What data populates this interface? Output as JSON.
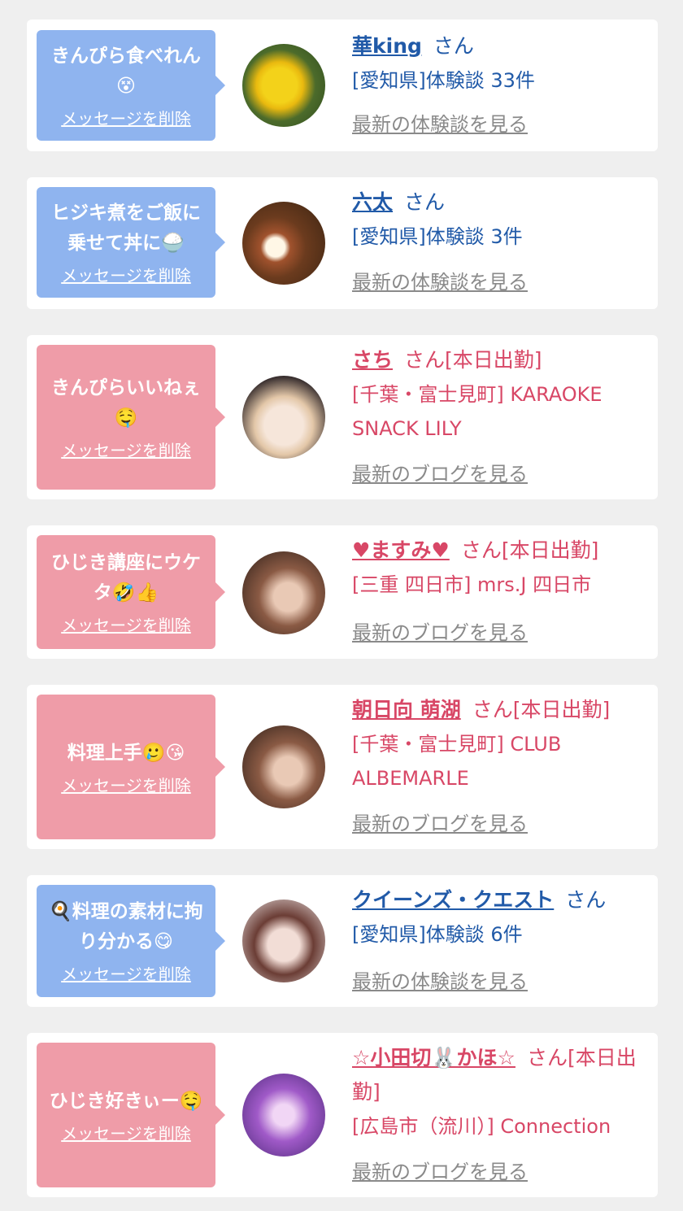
{
  "delete_label": "メッセージを削除",
  "colors": {
    "background": "#efefef",
    "male_bubble": "#8fb4ef",
    "female_bubble": "#ef9ca8",
    "male_text": "#215aa8",
    "female_text": "#d84766",
    "link_gray": "#8a8a8a"
  },
  "cards": [
    {
      "type": "male",
      "message": "きんぴら食べれん\n😵",
      "delete": "メッセージを削除",
      "name": "華king",
      "suffix": "さん",
      "detail": "[愛知県]体験談 33件",
      "latest": "最新の体験談を見る",
      "avatar": "yellow-hibiscus-photo"
    },
    {
      "type": "male",
      "message": "ヒジキ煮をご飯に\n乗せて丼に🍚",
      "delete": "メッセージを削除",
      "name": "六太",
      "suffix": "さん",
      "detail": "[愛知県]体験談 3件",
      "latest": "最新の体験談を見る",
      "avatar": "restaurant-dish-photo"
    },
    {
      "type": "female",
      "message": "きんぴらいいねぇ\n🤤",
      "delete": "メッセージを削除",
      "name": "さち",
      "suffix": "さん[本日出勤]",
      "detail": "[千葉・富士見町] KARAOKE SNACK LILY",
      "latest": "最新のブログを見る",
      "avatar": "blonde-woman-photo"
    },
    {
      "type": "female",
      "message": "ひじき講座にウケ\nタ🤣👍",
      "delete": "メッセージを削除",
      "name": "♥ますみ♥",
      "suffix": "さん[本日出勤]",
      "detail": "[三重 四日市] mrs.J 四日市",
      "latest": "最新のブログを見る",
      "avatar": "woman-portrait-photo"
    },
    {
      "type": "female",
      "message": "料理上手🥲😘",
      "delete": "メッセージを削除",
      "name": "朝日向 萌湖",
      "suffix": "さん[本日出勤]",
      "detail": "[千葉・富士見町] CLUB ALBEMARLE",
      "latest": "最新のブログを見る",
      "avatar": "woman-portrait-photo"
    },
    {
      "type": "male",
      "message": "🍳料理の素材に拘\nり分かる😋",
      "delete": "メッセージを削除",
      "name": "クイーンズ・クエスト",
      "suffix": "さん",
      "detail": "[愛知県]体験談 6件",
      "latest": "最新の体験談を見る",
      "avatar": "illustrated-woman-photo"
    },
    {
      "type": "female",
      "message": "ひじき好きぃー🤤",
      "delete": "メッセージを削除",
      "name": "☆小田切🐰かほ☆",
      "suffix": "さん[本日出勤]",
      "detail": "[広島市（流川）] Connection",
      "latest": "最新のブログを見る",
      "avatar": "purple-portrait-photo"
    }
  ]
}
